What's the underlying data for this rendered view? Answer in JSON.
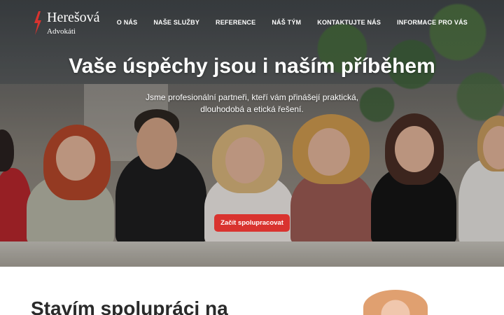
{
  "brand": {
    "name": "Herešová",
    "subtitle": "Advokáti",
    "accent": "#d9332f"
  },
  "nav": {
    "items": [
      {
        "label": "O NÁS"
      },
      {
        "label": "NAŠE SLUŽBY"
      },
      {
        "label": "REFERENCE"
      },
      {
        "label": "NÁŠ TÝM"
      },
      {
        "label": "KONTAKTUJTE NÁS"
      },
      {
        "label": "INFORMACE PRO VÁS"
      }
    ]
  },
  "hero": {
    "title": "Vaše úspěchy jsou i naším příběhem",
    "subtitle": "Jsme profesionální partneři, kteří vám přinášejí praktická, dlouhodobá a etická řešení.",
    "cta_label": "Začít spolupracovat",
    "image": "team-photo"
  },
  "section": {
    "title": "Stavím spolupráci na"
  }
}
